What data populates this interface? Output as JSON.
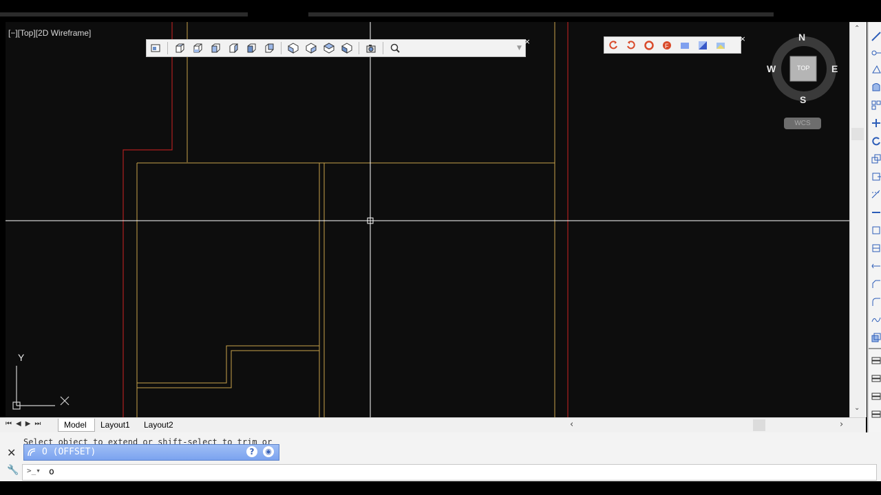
{
  "viewport": {
    "label": "[−][Top][2D Wireframe]"
  },
  "viewcube": {
    "north": "N",
    "south": "S",
    "east": "E",
    "west": "W",
    "face": "TOP",
    "wcs": "WCS"
  },
  "ucs": {
    "y_label": "Y",
    "x_label": "X"
  },
  "tabs": {
    "model": "Model",
    "layout1": "Layout1",
    "layout2": "Layout2"
  },
  "command": {
    "history_text": "Select object to extend or shift-select to trim or",
    "popup_text": "O (OFFSET)",
    "input_value": "o"
  },
  "colors": {
    "viewport_bg": "#0d0d0d",
    "red_line": "#b02020",
    "yellow_line": "#c9a24a",
    "crosshair": "#ffffff",
    "popup_blue": "#7ba3ef"
  }
}
